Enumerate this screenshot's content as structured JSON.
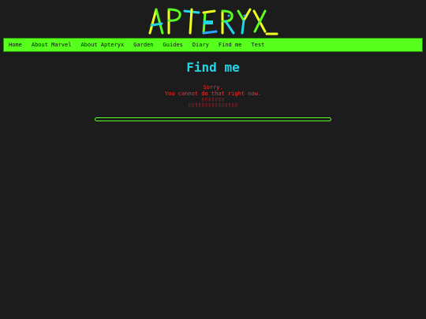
{
  "site": {
    "logo_text": "APTERYX_",
    "logo_colors": [
      "#f0ff1f",
      "#5aff1f",
      "#22d6e8",
      "#2aa7ff"
    ]
  },
  "nav": {
    "items": [
      {
        "label": "Home"
      },
      {
        "label": "About Marvel"
      },
      {
        "label": "About Apteryx"
      },
      {
        "label": "Garden"
      },
      {
        "label": "Guides"
      },
      {
        "label": "Diary"
      },
      {
        "label": "Find me"
      },
      {
        "label": "Test"
      }
    ],
    "background_color": "#57ff1d"
  },
  "main": {
    "title": "Find me",
    "message": {
      "sorry": "Sorry.",
      "cannot": "You cannot do that right now.",
      "glyph_line_1": "▯▯▯▯▯▯▯",
      "glyph_line_2": "▯▯▯▯▯▯▯▯▯▯▯▯▯▯▯"
    }
  },
  "colors": {
    "background": "#1c1c1c",
    "title": "#22d6e8",
    "error_text": "#ff2d2d",
    "accent_green": "#57ff1d"
  }
}
